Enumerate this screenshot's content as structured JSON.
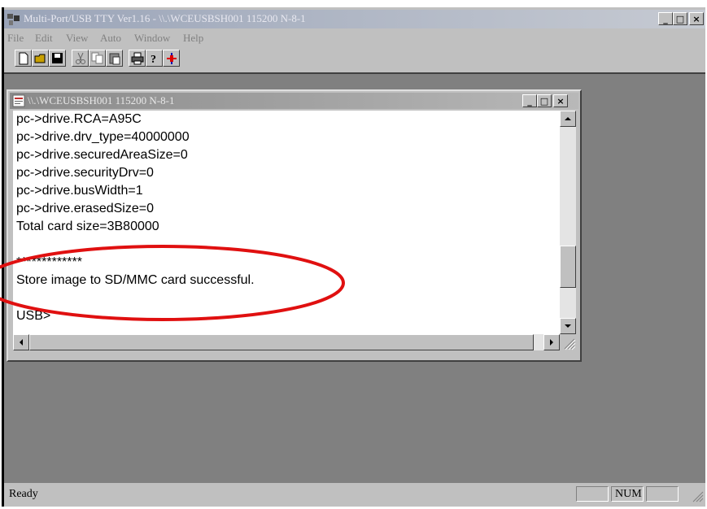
{
  "app": {
    "title": "Multi-Port/USB TTY Ver1.16 - \\\\.\\WCEUSBSH001 115200  N-8-1",
    "menus": [
      {
        "label": "File"
      },
      {
        "label": "Edit"
      },
      {
        "label": "View"
      },
      {
        "label": "Auto"
      },
      {
        "label": "Window"
      },
      {
        "label": "Help"
      }
    ],
    "caption_buttons": {
      "minimize": "_",
      "maximize": "□",
      "close": "×"
    }
  },
  "toolbar": {
    "buttons": [
      "new-document-icon",
      "open-folder-icon",
      "save-disk-icon",
      "cut-scissors-icon",
      "copy-icon",
      "paste-icon",
      "print-icon",
      "help-question-icon",
      "connect-plug-icon"
    ]
  },
  "child": {
    "title": "\\\\.\\WCEUSBSH001 115200  N-8-1",
    "caption_buttons": {
      "minimize": "_",
      "maximize": "□",
      "close": "×"
    },
    "lines": [
      "pc->drive.RCA=A95C",
      "pc->drive.drv_type=40000000",
      "pc->drive.securedAreaSize=0",
      "pc->drive.securityDrv=0",
      "pc->drive.busWidth=1",
      "pc->drive.erasedSize=0",
      "Total card size=3B80000",
      "",
      "*************",
      "Store image to SD/MMC card successful.",
      "",
      "USB>"
    ],
    "vscroll_position": 0.8
  },
  "status": {
    "text": "Ready",
    "num_indicator": "NUM"
  },
  "colors": {
    "annotation": "#e01010",
    "face": "#c0c0c0",
    "workspace": "#808080"
  }
}
